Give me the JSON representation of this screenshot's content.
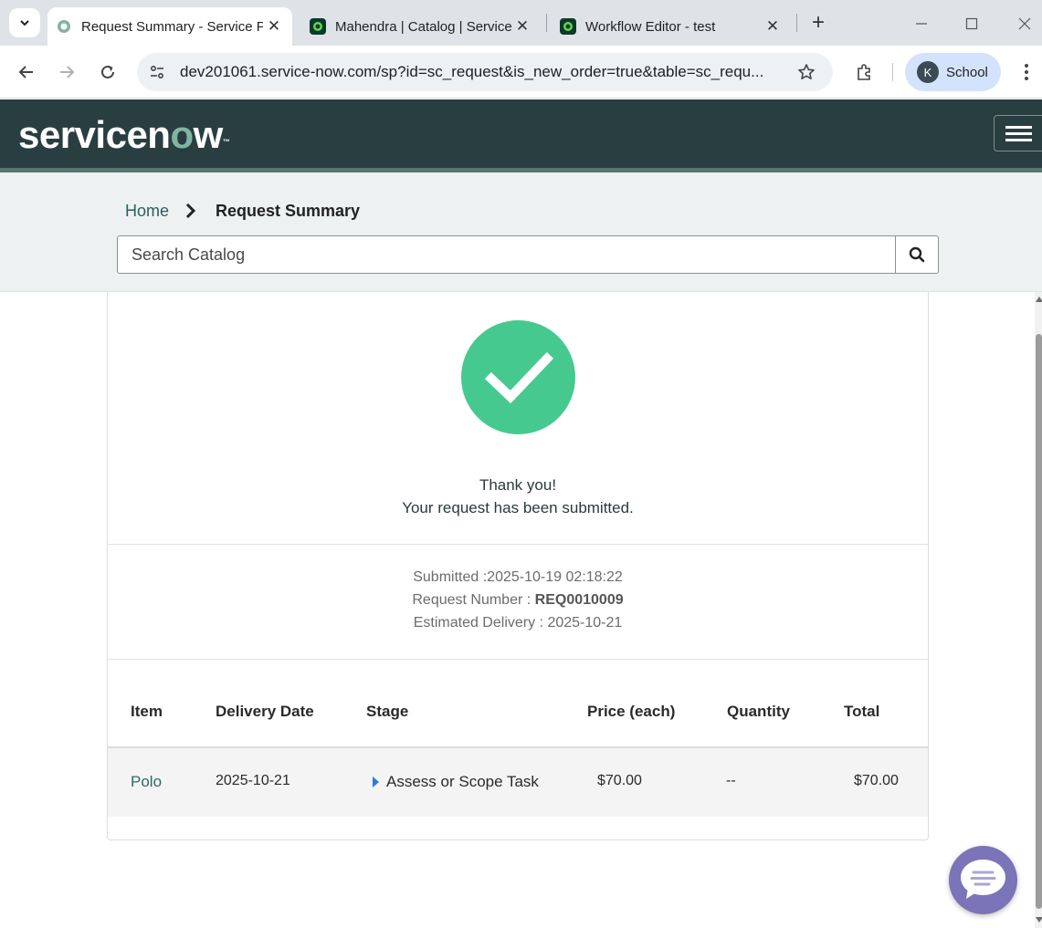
{
  "browser": {
    "tabs": [
      {
        "title": "Request Summary - Service Portal",
        "active": true
      },
      {
        "title": "Mahendra | Catalog | ServiceNow",
        "active": false
      },
      {
        "title": "Workflow Editor - test",
        "active": false
      }
    ],
    "url": "dev201061.service-now.com/sp?id=sc_request&is_new_order=true&table=sc_requ...",
    "profile": {
      "initial": "K",
      "label": "School"
    }
  },
  "header": {
    "logo_text_a": "servicen",
    "logo_text_o": "o",
    "logo_text_b": "w",
    "logo_tm": "™"
  },
  "breadcrumb": {
    "home": "Home",
    "current": "Request Summary"
  },
  "search": {
    "placeholder": "Search Catalog"
  },
  "confirmation": {
    "line1": "Thank you!",
    "line2": "Your request has been submitted.",
    "submitted_label": "Submitted :",
    "submitted_value": "2025-10-19 02:18:22",
    "request_label": "Request Number :",
    "request_value": "REQ0010009",
    "delivery_label": "Estimated Delivery :",
    "delivery_value": "2025-10-21"
  },
  "table": {
    "headers": [
      "Item",
      "Delivery Date",
      "Stage",
      "Price (each)",
      "Quantity",
      "Total"
    ],
    "rows": [
      {
        "item": "Polo",
        "delivery_date": "2025-10-21",
        "stage": "Assess or Scope Task",
        "price": "$70.00",
        "quantity": "--",
        "total": "$70.00"
      }
    ]
  },
  "colors": {
    "header_bg": "#293e40",
    "success": "#46c98e",
    "link": "#2d6a62",
    "chat": "#7b74b8"
  },
  "icons": [
    "chevron-down-icon",
    "close-icon",
    "plus-icon",
    "minimize-icon",
    "maximize-icon",
    "back-icon",
    "forward-icon",
    "reload-icon",
    "site-settings-icon",
    "star-icon",
    "extensions-icon",
    "more-icon",
    "menu-icon",
    "chevron-right-icon",
    "search-icon",
    "checkmark-icon",
    "caret-right-icon",
    "chat-icon"
  ]
}
